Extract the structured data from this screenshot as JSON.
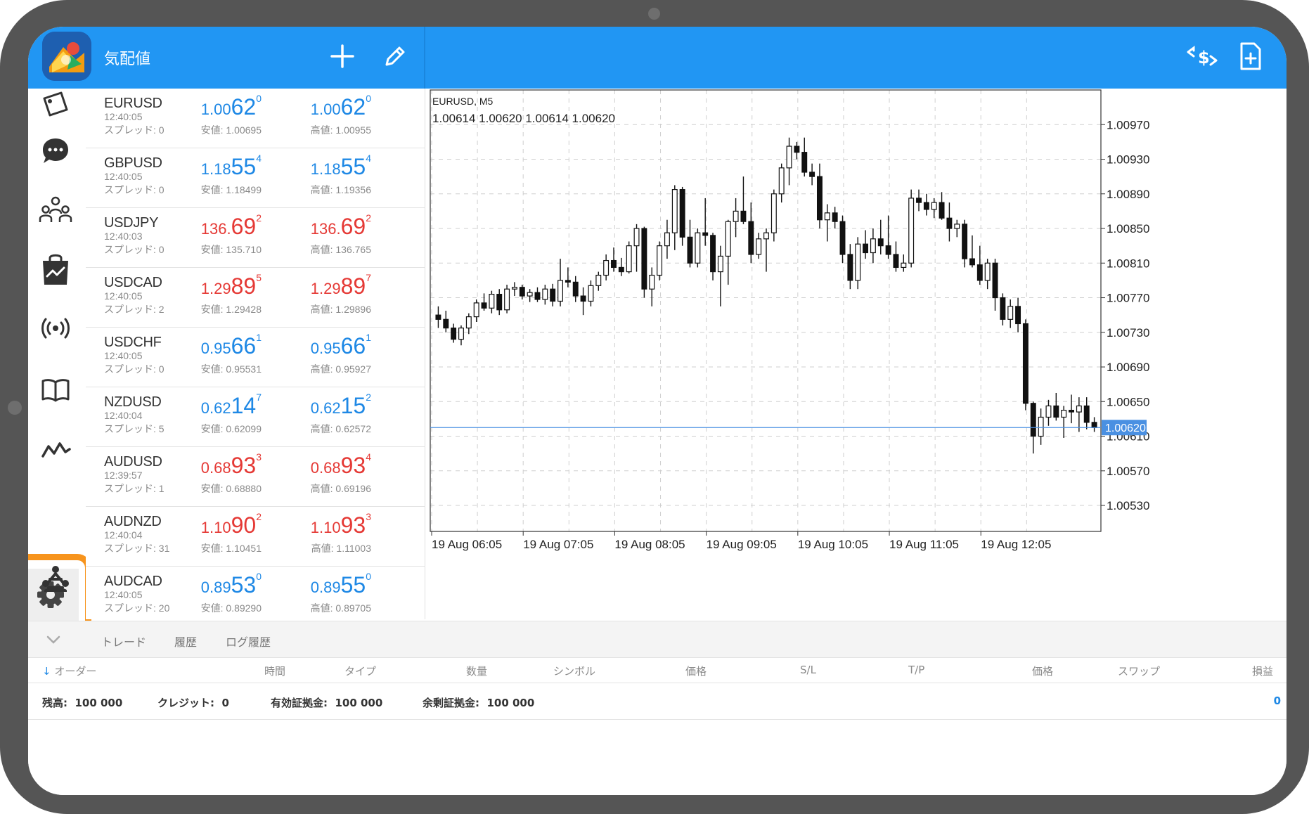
{
  "header": {
    "title": "気配値"
  },
  "quotes": [
    {
      "symbol": "EURUSD",
      "time": "12:40:05",
      "spread": "スプレッド: 0",
      "bid": {
        "a": "1.00",
        "b": "62",
        "c": "0",
        "color": "blue"
      },
      "ask": {
        "a": "1.00",
        "b": "62",
        "c": "0",
        "color": "blue"
      },
      "low": "安値: 1.00695",
      "high": "高値: 1.00955"
    },
    {
      "symbol": "GBPUSD",
      "time": "12:40:05",
      "spread": "スプレッド: 0",
      "bid": {
        "a": "1.18",
        "b": "55",
        "c": "4",
        "color": "blue"
      },
      "ask": {
        "a": "1.18",
        "b": "55",
        "c": "4",
        "color": "blue"
      },
      "low": "安値: 1.18499",
      "high": "高値: 1.19356"
    },
    {
      "symbol": "USDJPY",
      "time": "12:40:03",
      "spread": "スプレッド: 0",
      "bid": {
        "a": "136.",
        "b": "69",
        "c": "2",
        "color": "red"
      },
      "ask": {
        "a": "136.",
        "b": "69",
        "c": "2",
        "color": "red"
      },
      "low": "安値: 135.710",
      "high": "高値: 136.765"
    },
    {
      "symbol": "USDCAD",
      "time": "12:40:05",
      "spread": "スプレッド: 2",
      "bid": {
        "a": "1.29",
        "b": "89",
        "c": "5",
        "color": "red"
      },
      "ask": {
        "a": "1.29",
        "b": "89",
        "c": "7",
        "color": "red"
      },
      "low": "安値: 1.29428",
      "high": "高値: 1.29896"
    },
    {
      "symbol": "USDCHF",
      "time": "12:40:05",
      "spread": "スプレッド: 0",
      "bid": {
        "a": "0.95",
        "b": "66",
        "c": "1",
        "color": "blue"
      },
      "ask": {
        "a": "0.95",
        "b": "66",
        "c": "1",
        "color": "blue"
      },
      "low": "安値: 0.95531",
      "high": "高値: 0.95927"
    },
    {
      "symbol": "NZDUSD",
      "time": "12:40:04",
      "spread": "スプレッド: 5",
      "bid": {
        "a": "0.62",
        "b": "14",
        "c": "7",
        "color": "blue"
      },
      "ask": {
        "a": "0.62",
        "b": "15",
        "c": "2",
        "color": "blue"
      },
      "low": "安値: 0.62099",
      "high": "高値: 0.62572"
    },
    {
      "symbol": "AUDUSD",
      "time": "12:39:57",
      "spread": "スプレッド: 1",
      "bid": {
        "a": "0.68",
        "b": "93",
        "c": "3",
        "color": "red"
      },
      "ask": {
        "a": "0.68",
        "b": "93",
        "c": "4",
        "color": "red"
      },
      "low": "安値: 0.68880",
      "high": "高値: 0.69196"
    },
    {
      "symbol": "AUDNZD",
      "time": "12:40:04",
      "spread": "スプレッド: 31",
      "bid": {
        "a": "1.10",
        "b": "90",
        "c": "2",
        "color": "red"
      },
      "ask": {
        "a": "1.10",
        "b": "93",
        "c": "3",
        "color": "red"
      },
      "low": "安値: 1.10451",
      "high": "高値: 1.11003"
    },
    {
      "symbol": "AUDCAD",
      "time": "12:40:05",
      "spread": "スプレッド: 20",
      "bid": {
        "a": "0.89",
        "b": "53",
        "c": "0",
        "color": "blue"
      },
      "ask": {
        "a": "0.89",
        "b": "55",
        "c": "0",
        "color": "blue"
      },
      "low": "安値: 0.89290",
      "high": "高値: 0.89705"
    }
  ],
  "chart": {
    "symbol_label": "EURUSD, M5",
    "ohlc_label": "1.00614 1.00620 1.00614 1.00620",
    "current_price_label": "1.00620",
    "price_line_color": "#4a90e2"
  },
  "chart_data": {
    "type": "candlestick",
    "symbol": "EURUSD",
    "timeframe": "M5",
    "ylim": [
      1.005,
      1.0101
    ],
    "y_ticks": [
      "1.00970",
      "1.00930",
      "1.00890",
      "1.00850",
      "1.00810",
      "1.00770",
      "1.00730",
      "1.00690",
      "1.00650",
      "1.00610",
      "1.00570",
      "1.00530"
    ],
    "x_ticks": [
      "19 Aug 06:05",
      "19 Aug 07:05",
      "19 Aug 08:05",
      "19 Aug 09:05",
      "19 Aug 10:05",
      "19 Aug 11:05",
      "19 Aug 12:05"
    ],
    "current_price": 1.0062,
    "candles": [
      [
        1.0075,
        1.0076,
        1.00735,
        1.00745
      ],
      [
        1.00745,
        1.00755,
        1.0073,
        1.00735
      ],
      [
        1.00735,
        1.0074,
        1.00718,
        1.00722
      ],
      [
        1.00722,
        1.00738,
        1.00715,
        1.00735
      ],
      [
        1.00735,
        1.00752,
        1.00728,
        1.00748
      ],
      [
        1.00748,
        1.00768,
        1.00742,
        1.00764
      ],
      [
        1.00764,
        1.00775,
        1.00755,
        1.00758
      ],
      [
        1.00758,
        1.00778,
        1.00752,
        1.00774
      ],
      [
        1.00774,
        1.0078,
        1.0075,
        1.00756
      ],
      [
        1.00756,
        1.00785,
        1.00752,
        1.0078
      ],
      [
        1.0078,
        1.00788,
        1.00772,
        1.00782
      ],
      [
        1.00782,
        1.00785,
        1.00768,
        1.00772
      ],
      [
        1.00772,
        1.0078,
        1.00765,
        1.00776
      ],
      [
        1.00776,
        1.00782,
        1.00765,
        1.00768
      ],
      [
        1.00768,
        1.00785,
        1.00762,
        1.0078
      ],
      [
        1.0078,
        1.00786,
        1.0076,
        1.00766
      ],
      [
        1.00766,
        1.00815,
        1.0076,
        1.0079
      ],
      [
        1.0079,
        1.00805,
        1.00782,
        1.00788
      ],
      [
        1.00788,
        1.00795,
        1.00765,
        1.00772
      ],
      [
        1.00772,
        1.00782,
        1.0075,
        1.00766
      ],
      [
        1.00766,
        1.0079,
        1.0076,
        1.00784
      ],
      [
        1.00784,
        1.008,
        1.00778,
        1.00796
      ],
      [
        1.00796,
        1.0082,
        1.0079,
        1.00813
      ],
      [
        1.00813,
        1.00828,
        1.008,
        1.00805
      ],
      [
        1.00805,
        1.00816,
        1.00795,
        1.008
      ],
      [
        1.008,
        1.00835,
        1.00798,
        1.0083
      ],
      [
        1.0083,
        1.00855,
        1.008,
        1.0085
      ],
      [
        1.0085,
        1.00852,
        1.0077,
        1.0078
      ],
      [
        1.0078,
        1.00805,
        1.0076,
        1.00796
      ],
      [
        1.00796,
        1.00835,
        1.0079,
        1.0083
      ],
      [
        1.0083,
        1.0086,
        1.00815,
        1.00845
      ],
      [
        1.00845,
        1.009,
        1.00825,
        1.00895
      ],
      [
        1.00895,
        1.00898,
        1.0083,
        1.0084
      ],
      [
        1.0084,
        1.0086,
        1.00805,
        1.0081
      ],
      [
        1.0081,
        1.0085,
        1.00805,
        1.00845
      ],
      [
        1.00845,
        1.00885,
        1.0083,
        1.00842
      ],
      [
        1.00842,
        1.00845,
        1.0079,
        1.008
      ],
      [
        1.008,
        1.0083,
        1.0076,
        1.00818
      ],
      [
        1.00818,
        1.0086,
        1.00785,
        1.00858
      ],
      [
        1.00858,
        1.00885,
        1.0084,
        1.0087
      ],
      [
        1.0087,
        1.0091,
        1.00855,
        1.00858
      ],
      [
        1.00858,
        1.0088,
        1.0081,
        1.0082
      ],
      [
        1.0082,
        1.00845,
        1.00815,
        1.00838
      ],
      [
        1.00838,
        1.0085,
        1.008,
        1.00845
      ],
      [
        1.00845,
        1.00895,
        1.00835,
        1.0089
      ],
      [
        1.0089,
        1.00925,
        1.0088,
        1.0092
      ],
      [
        1.0092,
        1.00955,
        1.009,
        1.00945
      ],
      [
        1.00945,
        1.0095,
        1.0093,
        1.00938
      ],
      [
        1.00938,
        1.00955,
        1.0091,
        1.00915
      ],
      [
        1.00915,
        1.00925,
        1.009,
        1.0091
      ],
      [
        1.0091,
        1.00925,
        1.0085,
        1.0086
      ],
      [
        1.0086,
        1.00878,
        1.00835,
        1.00868
      ],
      [
        1.00868,
        1.00875,
        1.0085,
        1.00858
      ],
      [
        1.00858,
        1.00865,
        1.0081,
        1.0082
      ],
      [
        1.0082,
        1.00832,
        1.0078,
        1.0079
      ],
      [
        1.0079,
        1.0084,
        1.0078,
        1.00832
      ],
      [
        1.00832,
        1.00848,
        1.00815,
        1.00822
      ],
      [
        1.00822,
        1.0085,
        1.0081,
        1.00838
      ],
      [
        1.00838,
        1.0086,
        1.0082,
        1.0083
      ],
      [
        1.0083,
        1.00865,
        1.00815,
        1.0082
      ],
      [
        1.0082,
        1.00835,
        1.008,
        1.00805
      ],
      [
        1.00805,
        1.0082,
        1.008,
        1.0081
      ],
      [
        1.0081,
        1.00895,
        1.00805,
        1.00885
      ],
      [
        1.00885,
        1.00895,
        1.0087,
        1.0088
      ],
      [
        1.0088,
        1.0089,
        1.00865,
        1.00872
      ],
      [
        1.00872,
        1.00885,
        1.00862,
        1.0088
      ],
      [
        1.0088,
        1.00892,
        1.0086,
        1.00862
      ],
      [
        1.00862,
        1.0088,
        1.00835,
        1.0085
      ],
      [
        1.0085,
        1.0086,
        1.0084,
        1.00855
      ],
      [
        1.00855,
        1.0086,
        1.00805,
        1.00815
      ],
      [
        1.00815,
        1.00842,
        1.00805,
        1.00808
      ],
      [
        1.00808,
        1.0083,
        1.00785,
        1.0079
      ],
      [
        1.0079,
        1.00815,
        1.0078,
        1.0081
      ],
      [
        1.0081,
        1.00815,
        1.00755,
        1.0077
      ],
      [
        1.0077,
        1.00775,
        1.00738,
        1.00745
      ],
      [
        1.00745,
        1.00768,
        1.00735,
        1.0076
      ],
      [
        1.0076,
        1.0077,
        1.0073,
        1.0074
      ],
      [
        1.0074,
        1.00745,
        1.0064,
        1.00648
      ],
      [
        1.00648,
        1.0065,
        1.0059,
        1.0061
      ],
      [
        1.0061,
        1.00642,
        1.006,
        1.00632
      ],
      [
        1.00632,
        1.00652,
        1.00622,
        1.00645
      ],
      [
        1.00645,
        1.0066,
        1.00628,
        1.00632
      ],
      [
        1.00632,
        1.00645,
        1.00608,
        1.0064
      ],
      [
        1.0064,
        1.00658,
        1.00625,
        1.00638
      ],
      [
        1.00638,
        1.00655,
        1.00615,
        1.00645
      ],
      [
        1.00645,
        1.00655,
        1.00618,
        1.00626
      ],
      [
        1.00626,
        1.00632,
        1.00615,
        1.0062
      ]
    ]
  },
  "toolbox": {
    "tabs": [
      "トレード",
      "履歴",
      "ログ履歴"
    ],
    "columns": [
      "オーダー",
      "時間",
      "タイプ",
      "数量",
      "シンボル",
      "価格",
      "S/L",
      "T/P",
      "価格",
      "スワップ",
      "損益"
    ],
    "summary": {
      "balance_label": "残高:",
      "balance": "100 000",
      "credit_label": "クレジット:",
      "credit": "0",
      "equity_label": "有効証拠金:",
      "equity": "100 000",
      "free_margin_label": "余剰証拠金:",
      "free_margin": "100 000",
      "profit": "0"
    }
  },
  "colors": {
    "header_blue": "#2196f3",
    "bid_blue": "#1e88e5",
    "ask_red": "#e53935",
    "highlight_orange": "#f7941d"
  }
}
